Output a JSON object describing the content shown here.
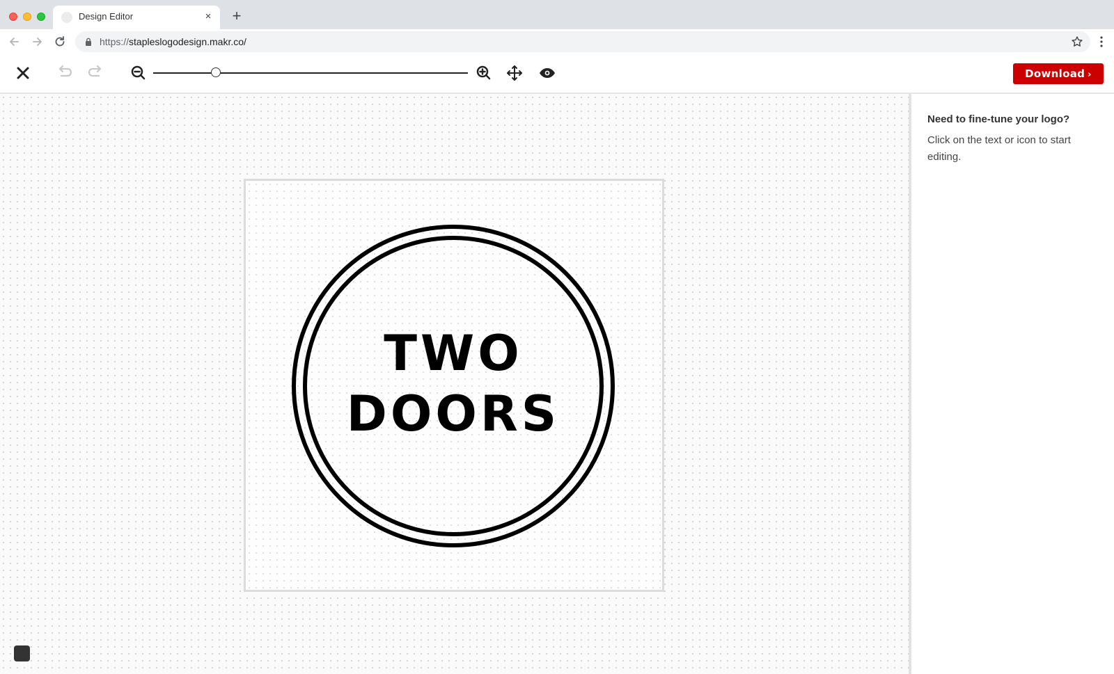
{
  "browser": {
    "tab_title": "Design Editor",
    "tab_close_glyph": "×",
    "new_tab_glyph": "+",
    "url_scheme": "https://",
    "url_rest": "stapleslogodesign.makr.co/"
  },
  "toolbar": {
    "download_label": "Download",
    "download_chevron": "›",
    "zoom_level": 0.2,
    "icons": [
      "close-icon",
      "undo-icon",
      "redo-icon",
      "zoom-out-icon",
      "zoom-in-icon",
      "move-icon",
      "preview-eye-icon"
    ]
  },
  "canvas": {
    "logo_line1": "TWO",
    "logo_line2": "DOORS"
  },
  "panel": {
    "title": "Need to fine-tune your logo?",
    "body": "Click on the text or icon to start editing."
  },
  "colors": {
    "accent": "#cc0000",
    "logo": "#000000",
    "chrome": "#dee1e6"
  }
}
